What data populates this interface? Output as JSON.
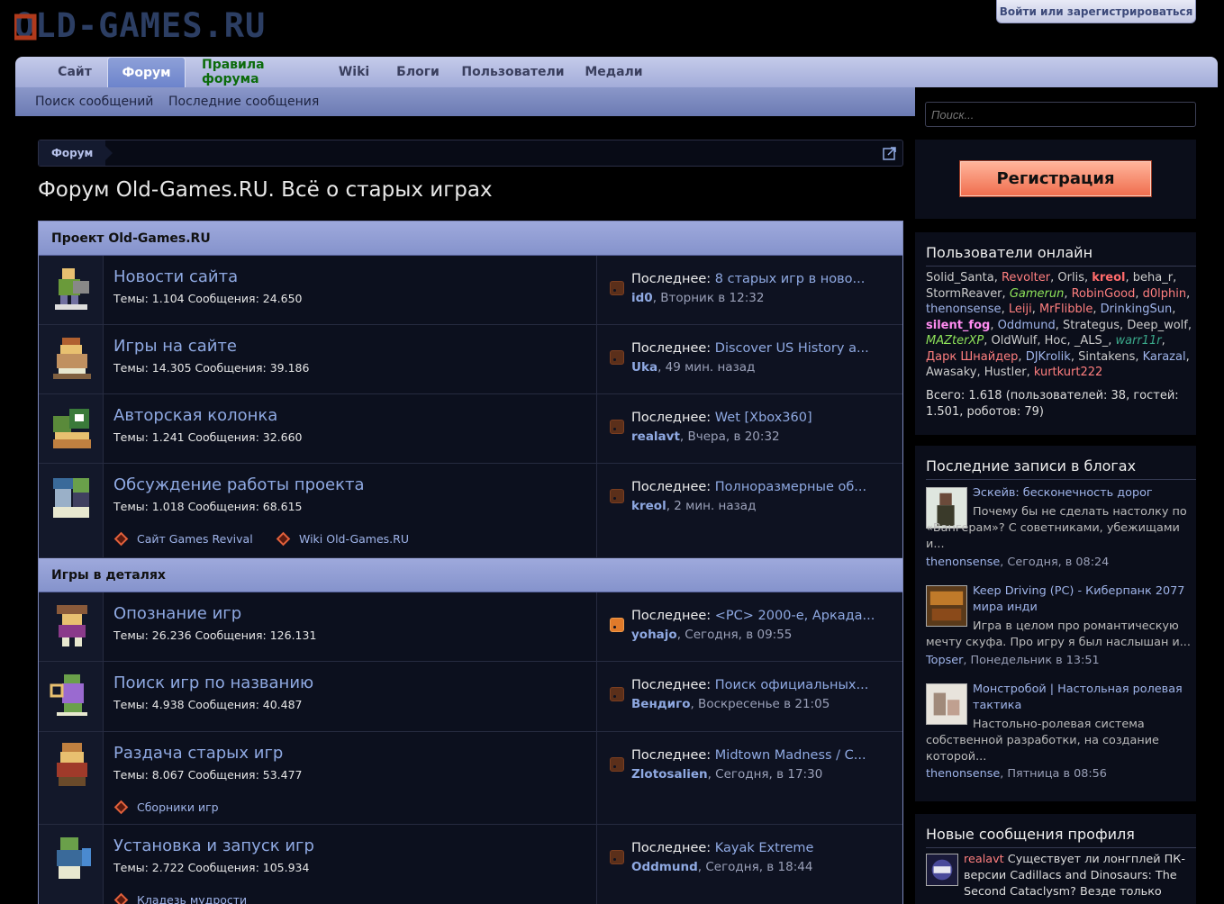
{
  "header": {
    "logo_text": "OLD-GAMES.RU",
    "login_label": "Войти или зарегистрироваться"
  },
  "nav": {
    "tabs": [
      "Сайт",
      "Форум",
      "Правила форума",
      "Wiki",
      "Блоги",
      "Пользователи",
      "Медали"
    ],
    "active": "Форум",
    "subtabs": [
      "Поиск сообщений",
      "Последние сообщения"
    ]
  },
  "breadcrumb": "Форум",
  "page_title": "Форум Old-Games.RU. Всё о старых играх",
  "categories": [
    {
      "name": "Проект Old-Games.RU"
    },
    {
      "name": "Игры в деталях"
    }
  ],
  "nodes": [
    {
      "title": "Новости сайта",
      "stats": "Темы: 1.104 Сообщения: 24.650",
      "last_label": "Последнее:",
      "last_thread": "8 старых игр в ново...",
      "last_user": "id0",
      "last_time": ", Вторник в 12:32",
      "subforums": []
    },
    {
      "title": "Игры на сайте",
      "stats": "Темы: 14.305 Сообщения: 39.186",
      "last_label": "Последнее:",
      "last_thread": "Discover US History a...",
      "last_user": "Uka",
      "last_time": ", 49 мин. назад",
      "subforums": []
    },
    {
      "title": "Авторская колонка",
      "stats": "Темы: 1.241 Сообщения: 32.660",
      "last_label": "Последнее:",
      "last_thread": "Wet [Xbox360]",
      "last_user": "realavt",
      "last_time": ", Вчера, в 20:32",
      "subforums": []
    },
    {
      "title": "Обсуждение работы проекта",
      "stats": "Темы: 1.018 Сообщения: 68.615",
      "last_label": "Последнее:",
      "last_thread": "Полноразмерные об...",
      "last_user": "kreol",
      "last_time": ", 2 мин. назад",
      "subforums": [
        "Сайт Games Revival",
        "Wiki Old-Games.RU"
      ]
    },
    {
      "title": "Опознание игр",
      "stats": "Темы: 26.236 Сообщения: 126.131",
      "last_label": "Последнее:",
      "last_thread": "<PC> 2000-е, Аркада...",
      "last_user": "yohajo",
      "last_time": ", Сегодня, в 09:55",
      "subforums": []
    },
    {
      "title": "Поиск игр по названию",
      "stats": "Темы: 4.938 Сообщения: 40.487",
      "last_label": "Последнее:",
      "last_thread": "Поиск официальных...",
      "last_user": "Вендиго",
      "last_time": ", Воскресенье в 21:05",
      "subforums": []
    },
    {
      "title": "Раздача старых игр",
      "stats": "Темы: 8.067 Сообщения: 53.477",
      "last_label": "Последнее:",
      "last_thread": "Midtown Madness / C...",
      "last_user": "Zlotosalien",
      "last_time": ", Сегодня, в 17:30",
      "subforums": [
        "Сборники игр"
      ]
    },
    {
      "title": "Установка и запуск игр",
      "stats": "Темы: 2.722 Сообщения: 105.934",
      "last_label": "Последнее:",
      "last_thread": "Kayak Extreme",
      "last_user": "Oddmund",
      "last_time": ", Сегодня, в 18:44",
      "subforums": [
        "Кладезь мудрости"
      ]
    }
  ],
  "sidebar": {
    "search_placeholder": "Поиск...",
    "register_label": "Регистрация",
    "online_title": "Пользователи онлайн",
    "online_users": [
      {
        "name": "Solid_Santa",
        "color": "#cccccc"
      },
      {
        "name": "Revolter",
        "color": "#ff7f7f"
      },
      {
        "name": "Orlis",
        "color": "#cccccc"
      },
      {
        "name": "kreol",
        "color": "#ff6b6b",
        "bold": true
      },
      {
        "name": "beha_r",
        "color": "#cccccc"
      },
      {
        "name": "StormReaver",
        "color": "#cccccc"
      },
      {
        "name": "Gamerun",
        "color": "#8ee35a",
        "italic": true
      },
      {
        "name": "RobinGood",
        "color": "#ff7f7f"
      },
      {
        "name": "d0lphin",
        "color": "#ff7f7f"
      },
      {
        "name": "thenonsense",
        "color": "#9fb4ea"
      },
      {
        "name": "Leiji",
        "color": "#ff7f7f"
      },
      {
        "name": "MrFlibble",
        "color": "#ff7f7f"
      },
      {
        "name": "DrinkingSun",
        "color": "#9fb4ea"
      },
      {
        "name": "silent_fog",
        "color": "#ff8cf0",
        "bold": true
      },
      {
        "name": "Oddmund",
        "color": "#9fb4ea"
      },
      {
        "name": "Strategus",
        "color": "#cccccc"
      },
      {
        "name": "Deep_wolf",
        "color": "#cccccc"
      },
      {
        "name": "MAZterXP",
        "color": "#8ee35a",
        "italic": true
      },
      {
        "name": "OldWulf",
        "color": "#cccccc"
      },
      {
        "name": "Hoc",
        "color": "#cccccc"
      },
      {
        "name": "_ALS_",
        "color": "#cccccc"
      },
      {
        "name": "warr11r",
        "color": "#3aa88a",
        "italic": true
      },
      {
        "name": "Дарк Шнайдер",
        "color": "#ff7f7f"
      },
      {
        "name": "DJKrolik",
        "color": "#9fb4ea"
      },
      {
        "name": "Sintakens",
        "color": "#cccccc"
      },
      {
        "name": "Karazal",
        "color": "#9fb4ea"
      },
      {
        "name": "Awasaky",
        "color": "#cccccc"
      },
      {
        "name": "Hustler",
        "color": "#cccccc"
      },
      {
        "name": "kurtkurt222",
        "color": "#ff7f7f"
      }
    ],
    "online_total": "Всего: 1.618 (пользователей: 38, гостей: 1.501, роботов: 79)",
    "blogs_title": "Последние записи в блогах",
    "blogs": [
      {
        "title": "Эскейв: бесконечность дорог",
        "excerpt": "Почему бы не сделать настолку по «Вангерам»? С советниками, убежищами и...",
        "author": "thenonsense",
        "time": ", Сегодня, в 08:24"
      },
      {
        "title": "Keep Driving (PC) - Киберпанк 2077 мира инди",
        "excerpt": "Игра в целом про романтическую мечту скуфа. Про игру я был наслышан и...",
        "author": "Topser",
        "time": ", Понедельник в 13:51"
      },
      {
        "title": "Монстробой | Настольная ролевая тактика",
        "excerpt": "Настольно-ролевая система собственной разработки, на создание которой...",
        "author": "thenonsense",
        "time": ", Пятница в 08:56"
      }
    ],
    "profile_title": "Новые сообщения профиля",
    "profile_post": {
      "author": "realavt",
      "text": "Существует ли лонгплей ПК-версии Cadillacs and Dinosaurs: The Second Cataclysm? Везде только"
    }
  },
  "colors": {
    "accent_link": "#8fa9e2",
    "nav_bg": "#a3acd9",
    "category_bg": "#8593cc",
    "register_btn": "#f06e4f"
  }
}
